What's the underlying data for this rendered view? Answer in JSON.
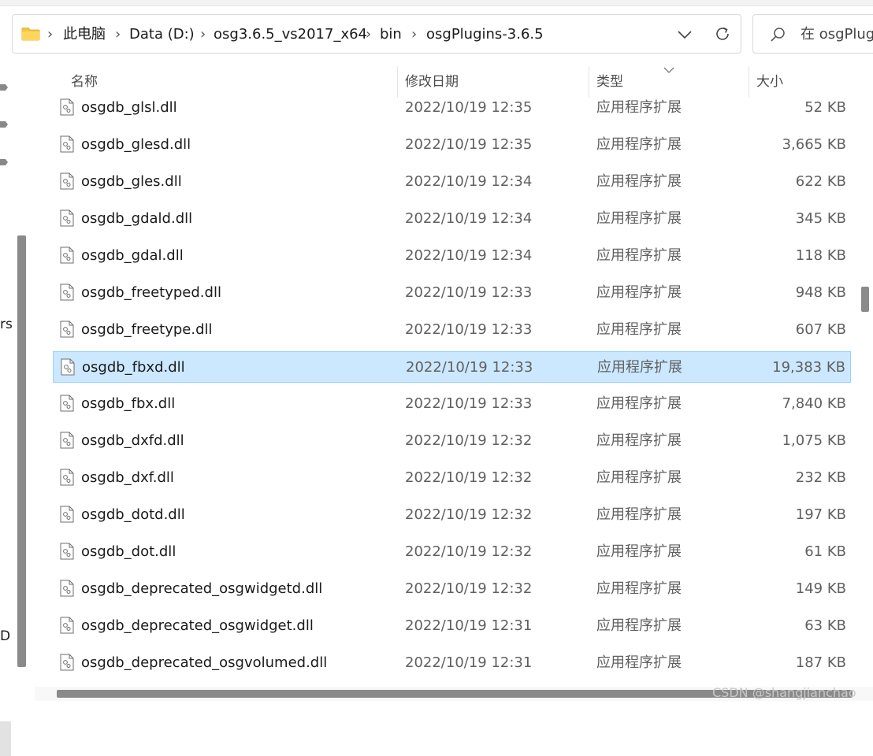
{
  "address": {
    "breadcrumbs": [
      "此电脑",
      "Data (D:)",
      "osg3.6.5_vs2017_x64",
      "bin",
      "osgPlugins-3.6.5"
    ],
    "separator": "›"
  },
  "search": {
    "placeholder": "在 osgPlug"
  },
  "nav_fragments": [
    "rs",
    "D"
  ],
  "columns": {
    "name": "名称",
    "date": "修改日期",
    "type": "类型",
    "size": "大小"
  },
  "files": [
    {
      "name": "osgdb_glsl.dll",
      "date": "2022/10/19 12:35",
      "type": "应用程序扩展",
      "size": "52 KB"
    },
    {
      "name": "osgdb_glesd.dll",
      "date": "2022/10/19 12:35",
      "type": "应用程序扩展",
      "size": "3,665 KB"
    },
    {
      "name": "osgdb_gles.dll",
      "date": "2022/10/19 12:34",
      "type": "应用程序扩展",
      "size": "622 KB"
    },
    {
      "name": "osgdb_gdald.dll",
      "date": "2022/10/19 12:34",
      "type": "应用程序扩展",
      "size": "345 KB"
    },
    {
      "name": "osgdb_gdal.dll",
      "date": "2022/10/19 12:34",
      "type": "应用程序扩展",
      "size": "118 KB"
    },
    {
      "name": "osgdb_freetyped.dll",
      "date": "2022/10/19 12:33",
      "type": "应用程序扩展",
      "size": "948 KB"
    },
    {
      "name": "osgdb_freetype.dll",
      "date": "2022/10/19 12:33",
      "type": "应用程序扩展",
      "size": "607 KB"
    },
    {
      "name": "osgdb_fbxd.dll",
      "date": "2022/10/19 12:33",
      "type": "应用程序扩展",
      "size": "19,383 KB",
      "selected": true
    },
    {
      "name": "osgdb_fbx.dll",
      "date": "2022/10/19 12:33",
      "type": "应用程序扩展",
      "size": "7,840 KB"
    },
    {
      "name": "osgdb_dxfd.dll",
      "date": "2022/10/19 12:32",
      "type": "应用程序扩展",
      "size": "1,075 KB"
    },
    {
      "name": "osgdb_dxf.dll",
      "date": "2022/10/19 12:32",
      "type": "应用程序扩展",
      "size": "232 KB"
    },
    {
      "name": "osgdb_dotd.dll",
      "date": "2022/10/19 12:32",
      "type": "应用程序扩展",
      "size": "197 KB"
    },
    {
      "name": "osgdb_dot.dll",
      "date": "2022/10/19 12:32",
      "type": "应用程序扩展",
      "size": "61 KB"
    },
    {
      "name": "osgdb_deprecated_osgwidgetd.dll",
      "date": "2022/10/19 12:32",
      "type": "应用程序扩展",
      "size": "149 KB"
    },
    {
      "name": "osgdb_deprecated_osgwidget.dll",
      "date": "2022/10/19 12:31",
      "type": "应用程序扩展",
      "size": "63 KB"
    },
    {
      "name": "osgdb_deprecated_osgvolumed.dll",
      "date": "2022/10/19 12:31",
      "type": "应用程序扩展",
      "size": "187 KB"
    }
  ],
  "icons": [
    "folder-icon",
    "chevron-right-icon",
    "chevron-down-icon",
    "refresh-icon",
    "search-icon",
    "pin-icon",
    "dll-file-icon",
    "sort-arrow-icon"
  ],
  "colors": {
    "selection_bg": "#cce8ff",
    "selection_border": "#99d1ff",
    "folder": "#f4c542"
  },
  "watermark": "CSDN @shangjianchao"
}
